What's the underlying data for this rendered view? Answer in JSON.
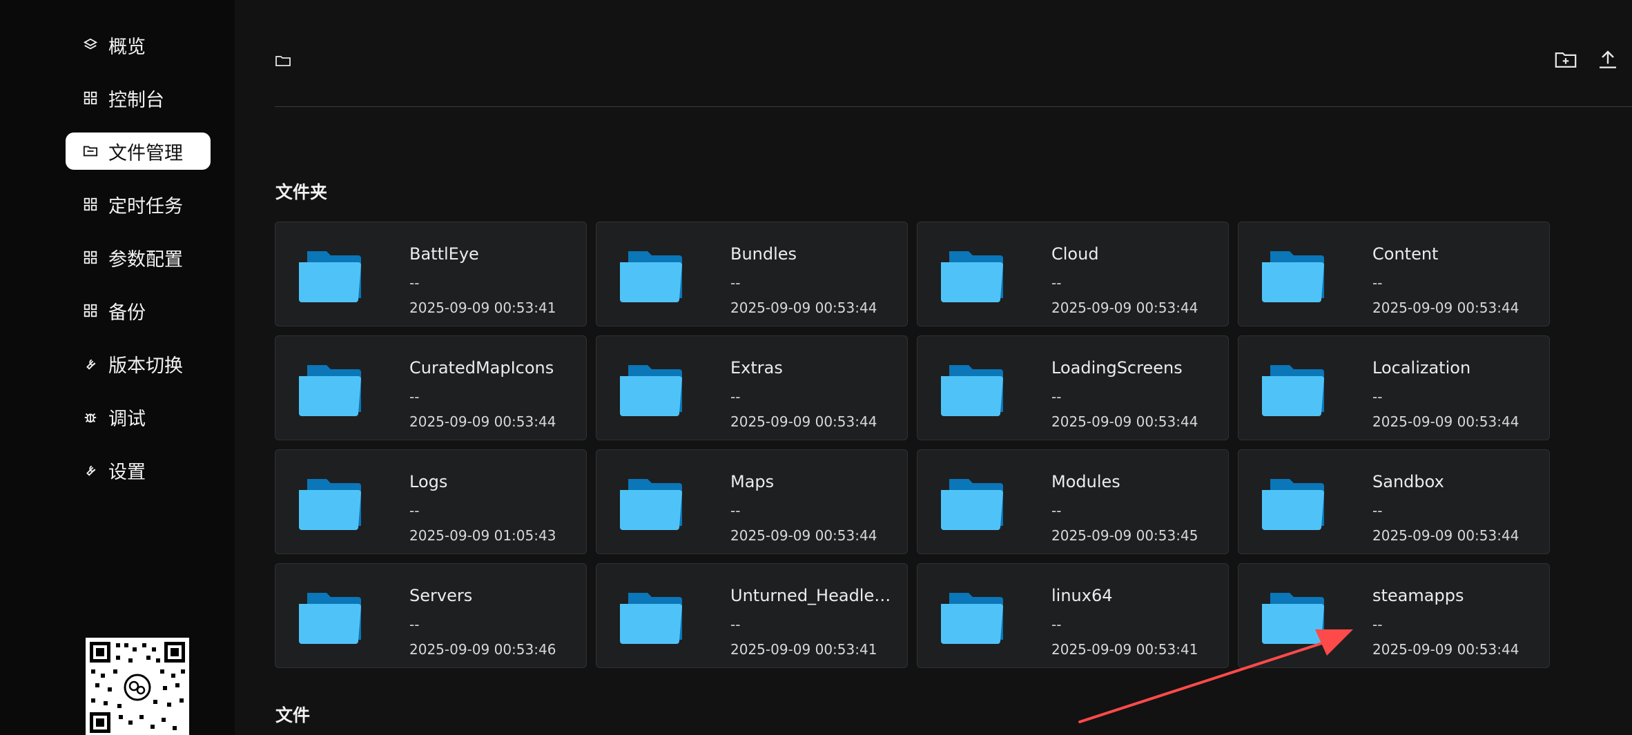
{
  "sidebar": {
    "items": [
      {
        "label": "概览",
        "icon": "layers-icon",
        "active": false
      },
      {
        "label": "控制台",
        "icon": "grid-icon",
        "active": false
      },
      {
        "label": "文件管理",
        "icon": "folder-icon",
        "active": true
      },
      {
        "label": "定时任务",
        "icon": "grid-icon",
        "active": false
      },
      {
        "label": "参数配置",
        "icon": "grid-icon",
        "active": false
      },
      {
        "label": "备份",
        "icon": "grid-icon",
        "active": false
      },
      {
        "label": "版本切换",
        "icon": "wrench-icon",
        "active": false
      },
      {
        "label": "调试",
        "icon": "bug-icon",
        "active": false
      },
      {
        "label": "设置",
        "icon": "wrench-icon",
        "active": false
      }
    ],
    "qr_icon": "qr-code"
  },
  "toolbar": {
    "path_icon": "folder-outline-icon",
    "new_folder_icon": "folder-plus-icon",
    "upload_icon": "upload-icon"
  },
  "sections": {
    "folders_title": "文件夹",
    "files_title": "文件"
  },
  "folders": [
    {
      "name": "BattlEye",
      "size": "--",
      "modified": "2025-09-09 00:53:41"
    },
    {
      "name": "Bundles",
      "size": "--",
      "modified": "2025-09-09 00:53:44"
    },
    {
      "name": "Cloud",
      "size": "--",
      "modified": "2025-09-09 00:53:44"
    },
    {
      "name": "Content",
      "size": "--",
      "modified": "2025-09-09 00:53:44"
    },
    {
      "name": "CuratedMapIcons",
      "size": "--",
      "modified": "2025-09-09 00:53:44"
    },
    {
      "name": "Extras",
      "size": "--",
      "modified": "2025-09-09 00:53:44"
    },
    {
      "name": "LoadingScreens",
      "size": "--",
      "modified": "2025-09-09 00:53:44"
    },
    {
      "name": "Localization",
      "size": "--",
      "modified": "2025-09-09 00:53:44"
    },
    {
      "name": "Logs",
      "size": "--",
      "modified": "2025-09-09 01:05:43"
    },
    {
      "name": "Maps",
      "size": "--",
      "modified": "2025-09-09 00:53:44"
    },
    {
      "name": "Modules",
      "size": "--",
      "modified": "2025-09-09 00:53:45"
    },
    {
      "name": "Sandbox",
      "size": "--",
      "modified": "2025-09-09 00:53:44"
    },
    {
      "name": "Servers",
      "size": "--",
      "modified": "2025-09-09 00:53:46"
    },
    {
      "name": "Unturned_Headle…",
      "size": "--",
      "modified": "2025-09-09 00:53:41"
    },
    {
      "name": "linux64",
      "size": "--",
      "modified": "2025-09-09 00:53:41"
    },
    {
      "name": "steamapps",
      "size": "--",
      "modified": "2025-09-09 00:53:44"
    }
  ],
  "colors": {
    "folder_back": "#0b76b8",
    "folder_front": "#4fc3f7",
    "arrow": "#ff4a4a"
  }
}
